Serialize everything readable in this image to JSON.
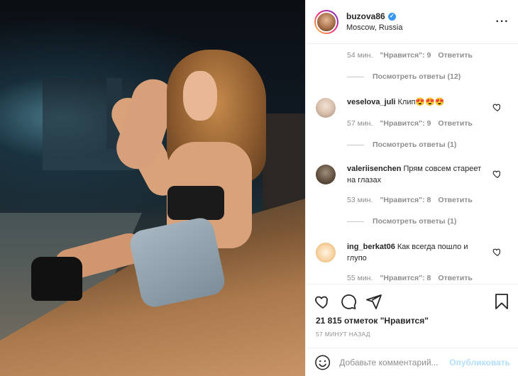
{
  "post": {
    "username": "buzova86",
    "location": "Moscow, Russia",
    "more_icon": "more-dots-icon"
  },
  "comments_top": {
    "time": "54 мин.",
    "likes": "\"Нравится\": 9",
    "reply": "Ответить",
    "view_replies": "Посмотреть ответы (12)"
  },
  "comments": [
    {
      "user": "veselova_juli",
      "text": "Клип😍😍😍",
      "time": "57 мин.",
      "likes": "\"Нравится\": 9",
      "reply": "Ответить",
      "view_replies": "Посмотреть ответы (1)"
    },
    {
      "user": "valeriisenchen",
      "text": "Прям совсем стареет на глазах",
      "time": "53 мин.",
      "likes": "\"Нравится\": 8",
      "reply": "Ответить",
      "view_replies": "Посмотреть ответы (1)"
    },
    {
      "user": "ing_berkat06",
      "text": "Как всегда пошло и глупо",
      "time": "55 мин.",
      "likes": "\"Нравится\": 8",
      "reply": "Ответить"
    }
  ],
  "actions": {
    "likes_count": "21 815 отметок \"Нравится\"",
    "time_ago": "57 МИНУТ НАЗАД"
  },
  "add_comment": {
    "placeholder": "Добавьте комментарий...",
    "publish": "Опубликовать"
  },
  "colors": {
    "verified": "#3897f0",
    "muted": "#8e8e8e",
    "publish_disabled": "#b2dffc"
  }
}
